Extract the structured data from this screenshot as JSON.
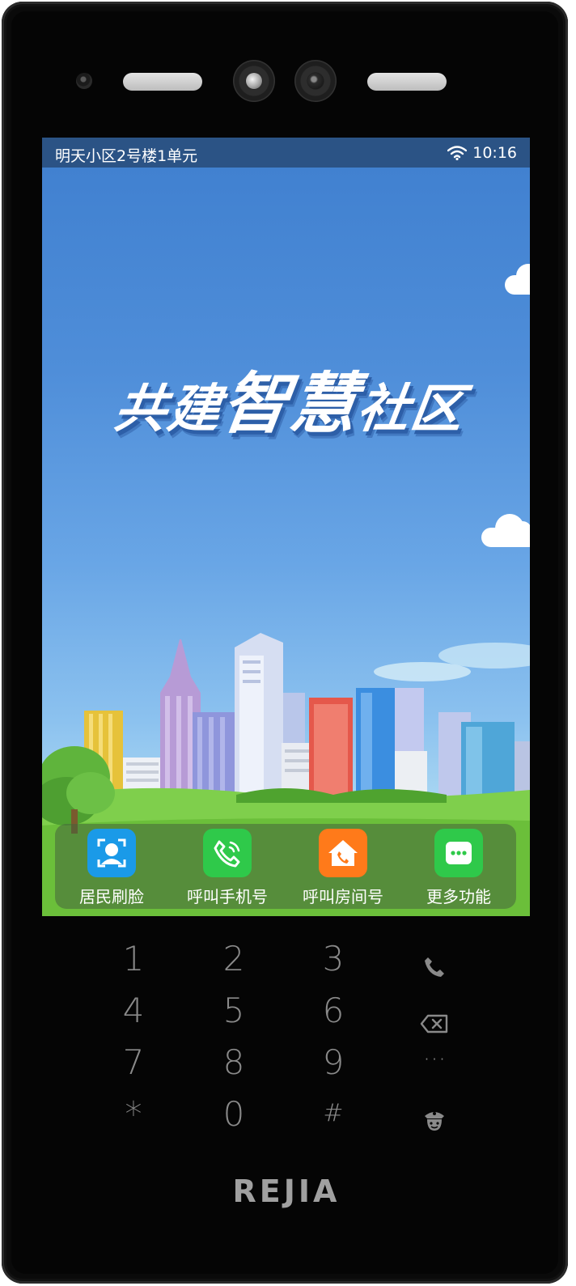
{
  "status_bar": {
    "location": "明天小区2号楼1单元",
    "time": "10:16",
    "wifi_icon": "wifi-icon"
  },
  "hero": {
    "part1": "共建",
    "part2": "智慧",
    "part3": "社区"
  },
  "dock": [
    {
      "label": "居民刷脸",
      "icon": "face-scan-icon",
      "color": "#1a9ae8"
    },
    {
      "label": "呼叫手机号",
      "icon": "phone-call-icon",
      "color": "#2fc94a"
    },
    {
      "label": "呼叫房间号",
      "icon": "house-call-icon",
      "color": "#ff7a1a"
    },
    {
      "label": "更多功能",
      "icon": "more-icon",
      "color": "#2fc94a"
    }
  ],
  "keypad": {
    "k1": "1",
    "k2": "2",
    "k3": "3",
    "k4": "4",
    "k5": "5",
    "k6": "6",
    "k7": "7",
    "k8": "8",
    "k9": "9",
    "kstar": "*",
    "k0": "0",
    "khash": "#",
    "more": "···"
  },
  "brand": "REJIA"
}
